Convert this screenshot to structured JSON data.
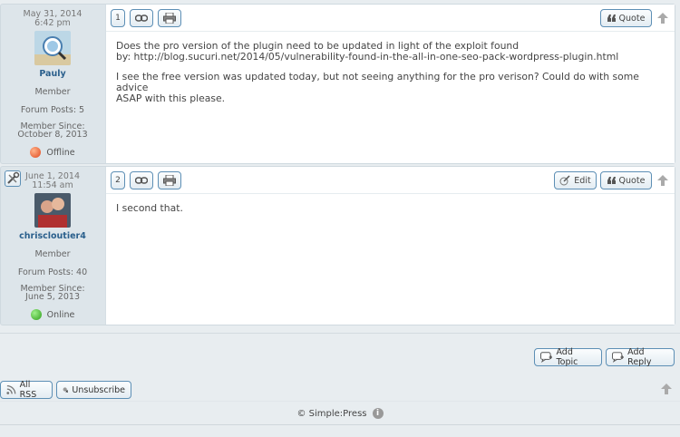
{
  "posts": [
    {
      "date": "May 31, 2014",
      "time": "6:42 pm",
      "username": "Pauly",
      "role": "Member",
      "forum_posts": "Forum Posts: 5",
      "member_since_label": "Member Since:",
      "member_since": "October 8, 2013",
      "status": "Offline",
      "number": "1",
      "quote_label": "Quote",
      "body": [
        "Does the pro version of the plugin need to be updated in light of the exploit found",
        "by: http://blog.sucuri.net/2014/05/vulnerability-found-in-the-all-in-one-seo-pack-wordpress-plugin.html",
        "I see the free version was updated today, but not seeing anything for the pro verison? Could do with some advice",
        "ASAP with this please."
      ]
    },
    {
      "date": "June 1, 2014",
      "time": "11:54 am",
      "username": "chriscloutier4",
      "role": "Member",
      "forum_posts": "Forum Posts: 40",
      "member_since_label": "Member Since:",
      "member_since": "June 5, 2013",
      "status": "Online",
      "number": "2",
      "edit_label": "Edit",
      "quote_label": "Quote",
      "body": [
        "I second that."
      ]
    }
  ],
  "actions": {
    "add_topic": "Add Topic",
    "add_reply": "Add Reply",
    "all_rss": "All RSS",
    "unsubscribe": "Unsubscribe"
  },
  "footer": {
    "copyright": "© Simple:Press",
    "info_glyph": "i"
  },
  "colors": {
    "accent": "#5d8fb5",
    "username": "#2a5f8c",
    "offline": "#e0471d",
    "online": "#2e9e1a"
  }
}
